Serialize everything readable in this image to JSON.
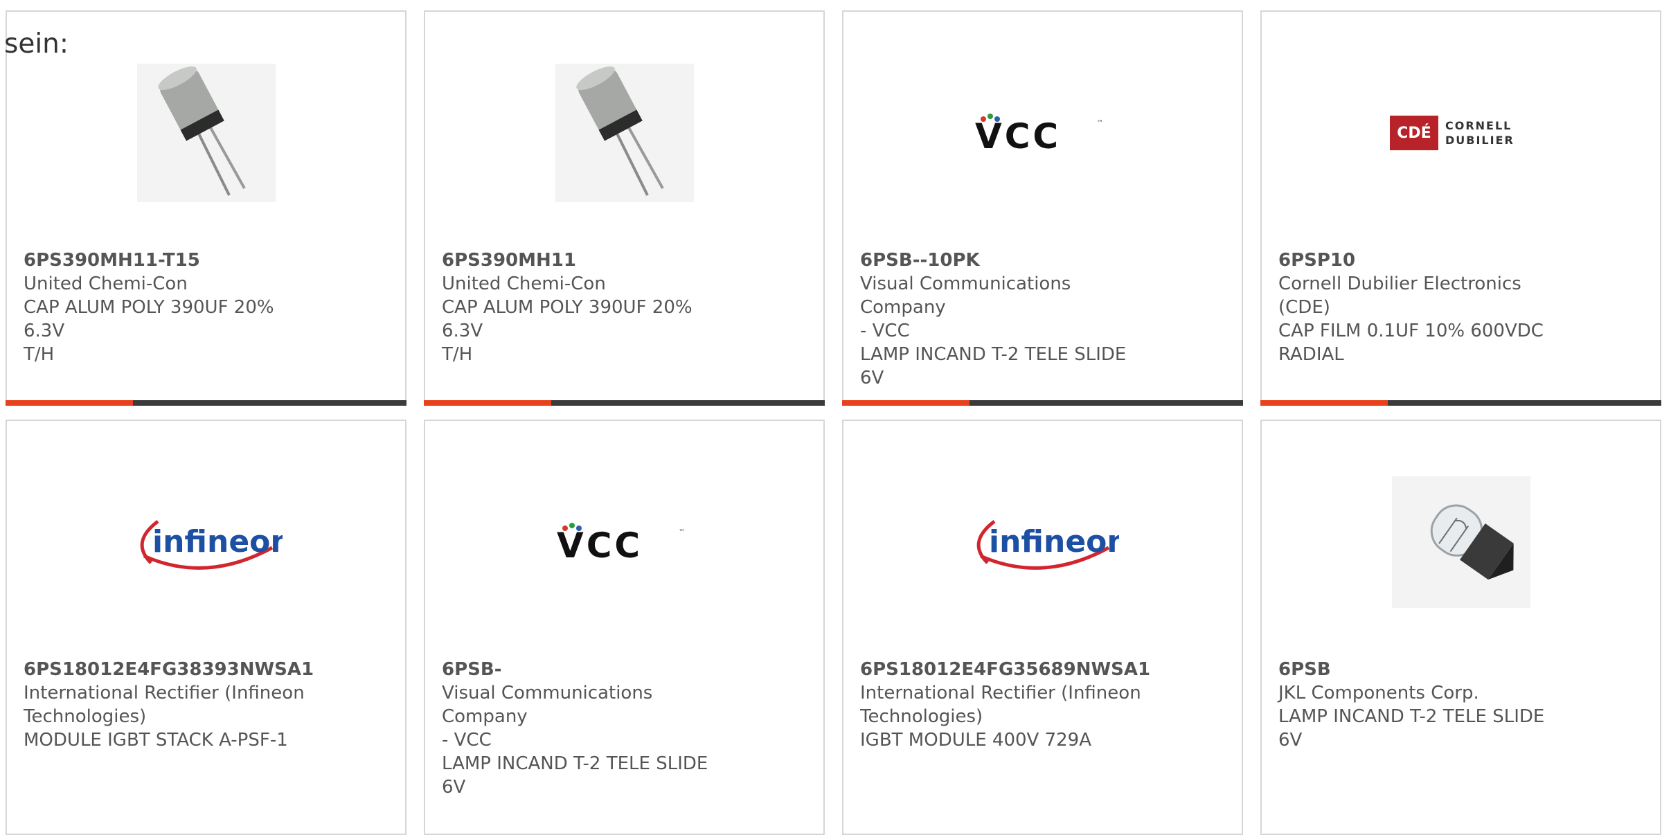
{
  "intro_text": "sein:",
  "colors": {
    "accent": "#e8411b",
    "bar_dark": "#3b3b3b",
    "card_border": "#d6d6d6",
    "text": "#555555"
  },
  "products": [
    {
      "part_number": "6PS390MH11-T15",
      "manufacturer": "United Chemi-Con",
      "desc_line1": "CAP ALUM POLY 390UF 20% 6.3V",
      "desc_line2": "T/H",
      "image": "capacitor-image"
    },
    {
      "part_number": "6PS390MH11",
      "manufacturer": "United Chemi-Con",
      "desc_line1": "CAP ALUM POLY 390UF 20% 6.3V",
      "desc_line2": "T/H",
      "image": "capacitor-image"
    },
    {
      "part_number": "6PSB--10PK",
      "manufacturer": "Visual Communications Company",
      "manufacturer_line2": "- VCC",
      "desc_line1": "LAMP INCAND T-2 TELE SLIDE",
      "desc_line2": "6V",
      "image": "vcc-logo",
      "logo_text": "VCC"
    },
    {
      "part_number": "6PSP10",
      "manufacturer": "Cornell Dubilier Electronics (CDE)",
      "desc_line1": "CAP FILM 0.1UF 10% 600VDC",
      "desc_line2": "RADIAL",
      "image": "cde-logo",
      "logo_badge": "CDÉ",
      "logo_line1": "CORNELL",
      "logo_line2": "DUBILIER"
    },
    {
      "part_number": "6PS18012E4FG38393NWSA1",
      "manufacturer": "International Rectifier (Infineon",
      "manufacturer_line2": "Technologies)",
      "desc_line1": "MODULE IGBT STACK A-PSF-1",
      "image": "infineon-logo",
      "logo_text": "infineon"
    },
    {
      "part_number": "6PSB-",
      "manufacturer": "Visual Communications Company",
      "manufacturer_line2": "- VCC",
      "desc_line1": "LAMP INCAND T-2 TELE SLIDE",
      "desc_line2": "6V",
      "image": "vcc-logo",
      "logo_text": "VCC"
    },
    {
      "part_number": "6PS18012E4FG35689NWSA1",
      "manufacturer": "International Rectifier (Infineon",
      "manufacturer_line2": "Technologies)",
      "desc_line1": "IGBT MODULE 400V 729A",
      "image": "infineon-logo",
      "logo_text": "infineon"
    },
    {
      "part_number": "6PSB",
      "manufacturer": "JKL Components Corp.",
      "desc_line1": "LAMP INCAND T-2 TELE SLIDE",
      "desc_line2": "6V",
      "image": "lamp-image"
    }
  ]
}
